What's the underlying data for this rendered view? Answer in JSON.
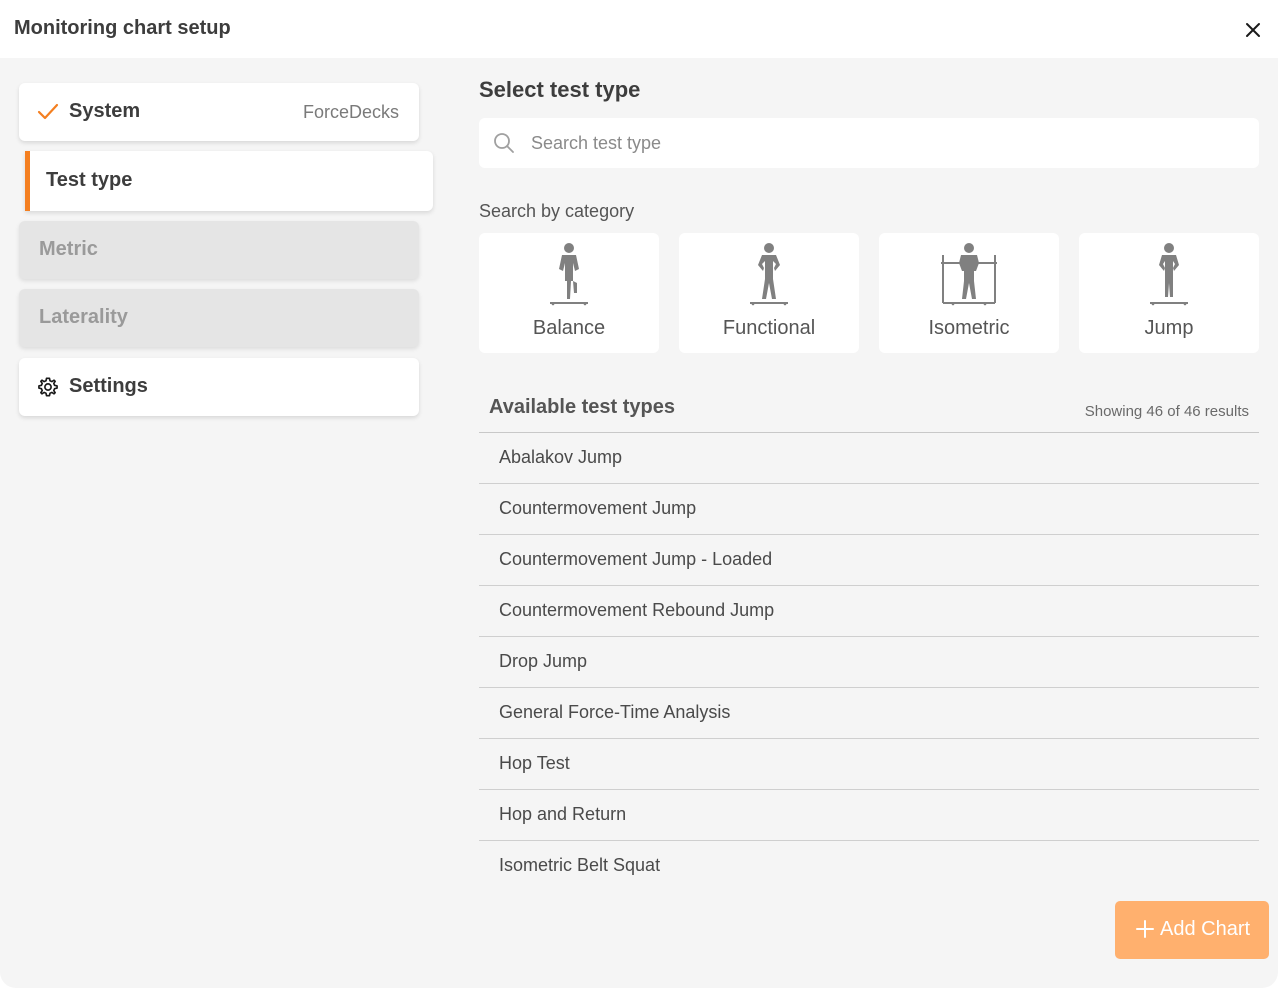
{
  "dialog": {
    "title": "Monitoring chart setup",
    "close_icon": "close-icon"
  },
  "steps": [
    {
      "label": "System",
      "value": "ForceDecks",
      "icon": "check-icon",
      "state": "completed"
    },
    {
      "label": "Test type",
      "state": "active"
    },
    {
      "label": "Metric",
      "state": "disabled"
    },
    {
      "label": "Laterality",
      "state": "disabled"
    },
    {
      "label": "Settings",
      "icon": "gear-icon",
      "state": "enabled"
    }
  ],
  "main": {
    "title": "Select test type",
    "search": {
      "placeholder": "Search test type",
      "value": "",
      "icon": "search-icon"
    },
    "category_label": "Search by category",
    "categories": [
      {
        "name": "Balance",
        "icon": "balance-figure-icon"
      },
      {
        "name": "Functional",
        "icon": "functional-figure-icon"
      },
      {
        "name": "Isometric",
        "icon": "isometric-figure-icon"
      },
      {
        "name": "Jump",
        "icon": "jump-figure-icon"
      }
    ],
    "list": {
      "title": "Available test types",
      "count": "Showing 46 of 46 results",
      "items": [
        "Abalakov Jump",
        "Countermovement Jump",
        "Countermovement Jump - Loaded",
        "Countermovement Rebound Jump",
        "Drop Jump",
        "General Force-Time Analysis",
        "Hop Test",
        "Hop and Return",
        "Isometric Belt Squat"
      ]
    }
  },
  "footer": {
    "add_label": "Add Chart",
    "add_icon": "plus-icon"
  },
  "colors": {
    "accent": "#f47f20",
    "button": "#ffb06e",
    "background": "#f5f5f5",
    "figure": "#808080"
  }
}
